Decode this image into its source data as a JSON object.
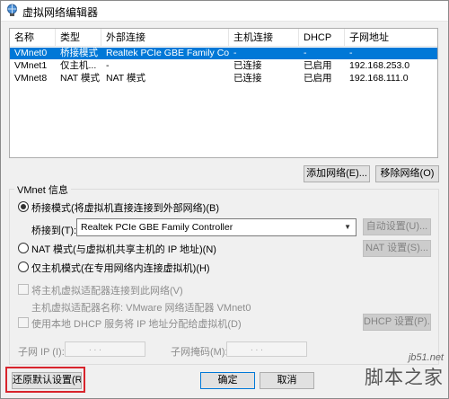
{
  "window": {
    "title": "虚拟网络编辑器"
  },
  "table": {
    "headers": [
      "名称",
      "类型",
      "外部连接",
      "主机连接",
      "DHCP",
      "子网地址"
    ],
    "rows": [
      {
        "name": "VMnet0",
        "type": "桥接模式",
        "external": "Realtek PCIe GBE Family Co...",
        "host": "-",
        "dhcp": "-",
        "subnet": "-",
        "selected": true
      },
      {
        "name": "VMnet1",
        "type": "仅主机...",
        "external": "-",
        "host": "已连接",
        "dhcp": "已启用",
        "subnet": "192.168.253.0",
        "selected": false
      },
      {
        "name": "VMnet8",
        "type": "NAT 模式",
        "external": "NAT 模式",
        "host": "已连接",
        "dhcp": "已启用",
        "subnet": "192.168.111.0",
        "selected": false
      }
    ]
  },
  "network_buttons": {
    "add": "添加网络(E)...",
    "remove": "移除网络(O)"
  },
  "vmnet_info": {
    "label": "VMnet 信息",
    "bridge_radio": "桥接模式(将虚拟机直接连接到外部网络)(B)",
    "bridge_to_label": "桥接到(T):",
    "bridge_to_value": "Realtek PCIe GBE Family Controller",
    "auto_settings": "自动设置(U)...",
    "nat_radio": "NAT 模式(与虚拟机共享主机的 IP 地址)(N)",
    "nat_settings": "NAT 设置(S)...",
    "hostonly_radio": "仅主机模式(在专用网络内连接虚拟机)(H)",
    "connect_adapter": "将主机虚拟适配器连接到此网络(V)",
    "adapter_name": "主机虚拟适配器名称: VMware 网络适配器 VMnet0",
    "use_dhcp": "使用本地 DHCP 服务将 IP 地址分配给虚拟机(D)",
    "dhcp_settings": "DHCP 设置(P)...",
    "subnet_ip_label": "子网 IP (I):",
    "subnet_mask_label": "子网掩码(M):",
    "ip_dots": ". . ."
  },
  "footer": {
    "restore_defaults": "还原默认设置(R)",
    "ok": "确定",
    "cancel": "取消"
  },
  "watermark": {
    "url": "jb51.net",
    "text": "脚本之家"
  },
  "colors": {
    "selection": "#0078d7",
    "highlight_box": "#d8242c"
  }
}
